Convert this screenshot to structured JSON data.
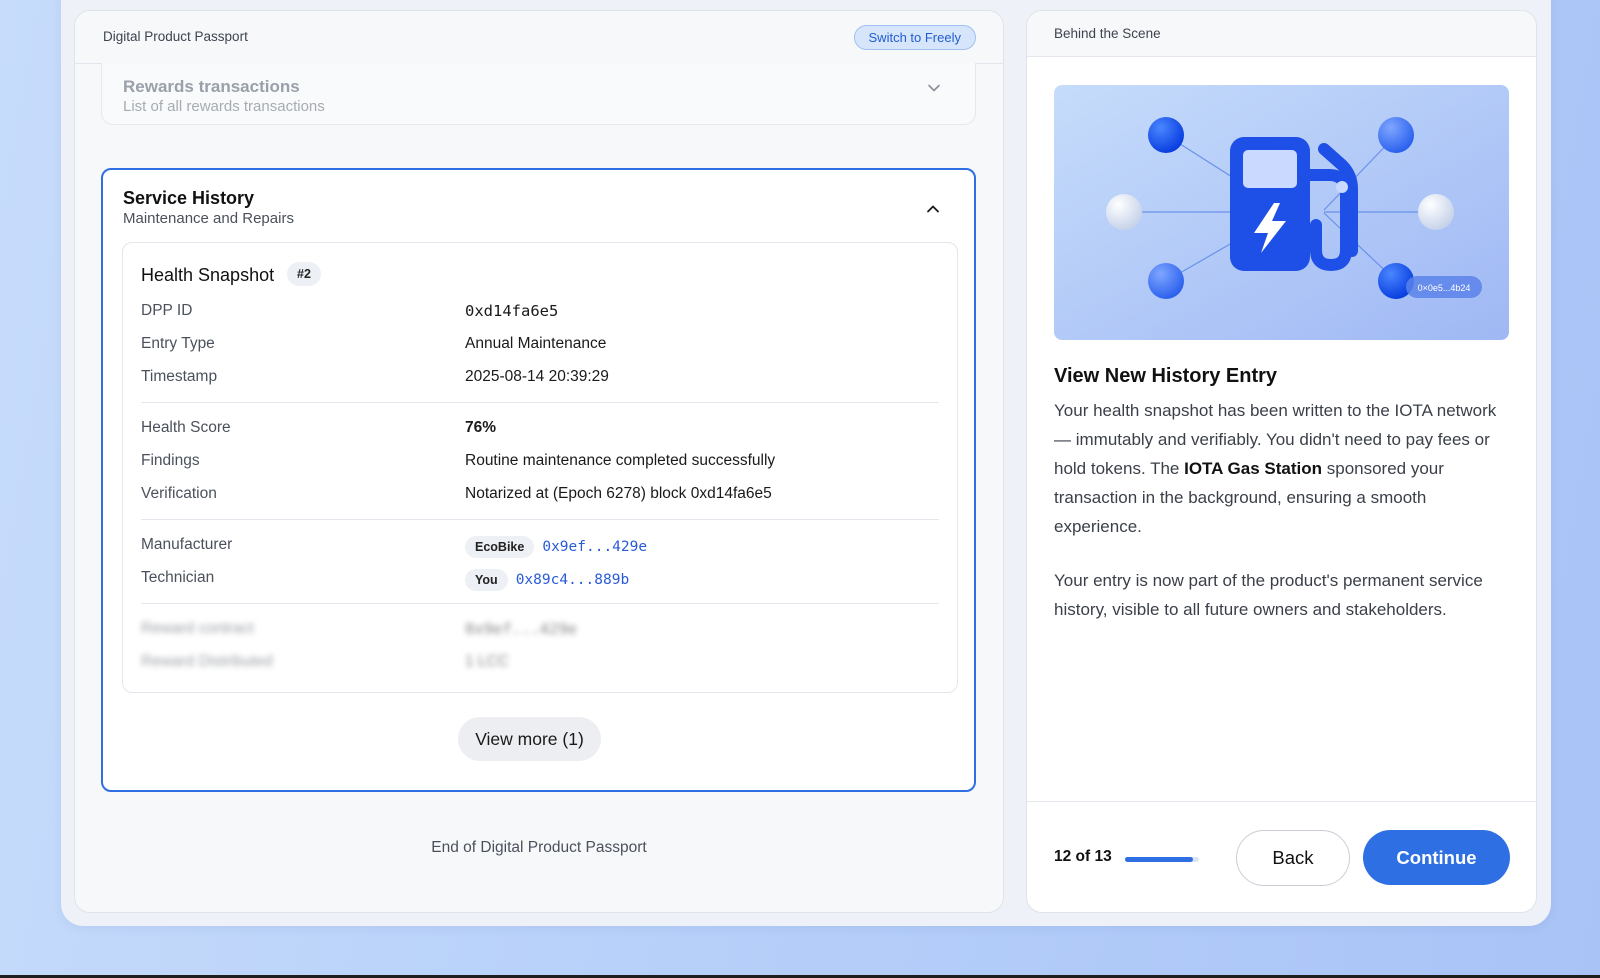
{
  "left_panel": {
    "title": "Digital Product Passport",
    "switch_label": "Switch to Freely",
    "rewards": {
      "title": "Rewards transactions",
      "subtitle": "List of all rewards transactions"
    },
    "service_history": {
      "title": "Service History",
      "subtitle": "Maintenance and Repairs",
      "snapshot": {
        "title": "Health Snapshot",
        "badge": "#2",
        "dpp_id_label": "DPP ID",
        "dpp_id": "0xd14fa6e5",
        "entry_type_label": "Entry Type",
        "entry_type": "Annual Maintenance",
        "timestamp_label": "Timestamp",
        "timestamp": "2025-08-14 20:39:29",
        "health_score_label": "Health Score",
        "health_score": "76%",
        "findings_label": "Findings",
        "findings": "Routine maintenance completed successfully",
        "verification_label": "Verification",
        "verification": "Notarized at (Epoch 6278) block 0xd14fa6e5",
        "manufacturer_label": "Manufacturer",
        "manufacturer_tag": "EcoBike",
        "manufacturer_address": "0x9ef...429e",
        "technician_label": "Technician",
        "technician_tag": "You",
        "technician_address": "0x89c4...889b",
        "reward_contract_label": "Reward contract",
        "reward_contract": "0x9ef...429e",
        "reward_distributed_label": "Reward Distributed",
        "reward_distributed": "1 LCC"
      },
      "view_more_label": "View more (1)"
    },
    "end_text": "End of Digital Product Passport"
  },
  "right_panel": {
    "title": "Behind the Scene",
    "hero": {
      "icon": "gas-station-lightning-icon",
      "address_chip": "0×0e5...4b24"
    },
    "heading": "View New History Entry",
    "paragraph1_part1": "Your health snapshot has been written to the IOTA network — immutably and verifiably. You didn't need to pay fees or hold tokens. The ",
    "paragraph1_bold": "IOTA Gas Station",
    "paragraph1_part2": " sponsored your transaction in the background, ensuring a smooth experience.",
    "paragraph2": "Your entry is now part of the product's permanent service history, visible to all future owners and stakeholders.",
    "step_text": "12 of 13",
    "progress": 0.92,
    "back_label": "Back",
    "continue_label": "Continue"
  },
  "colors": {
    "accent": "#2f6fe4",
    "link": "#2a5bd7",
    "background": "#b9d2fa"
  }
}
